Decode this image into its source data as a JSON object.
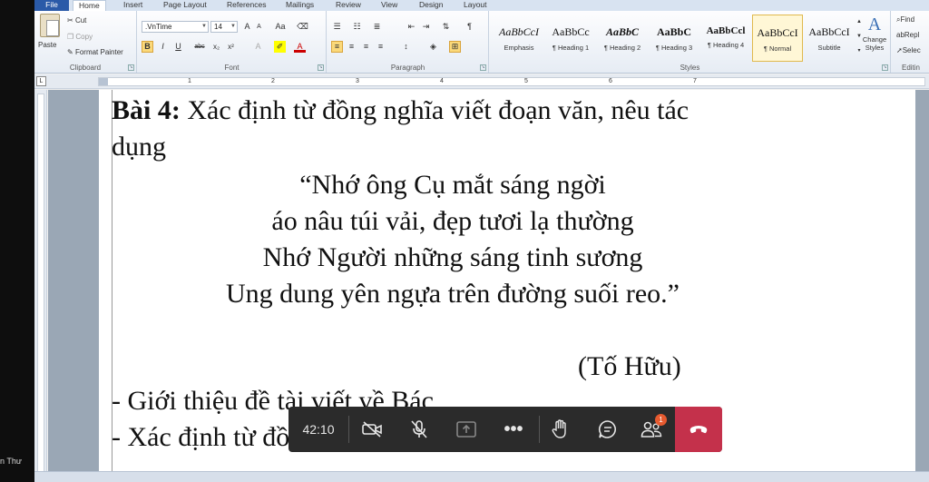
{
  "participant": {
    "name": "n Thư"
  },
  "ribbon": {
    "tabs": [
      "File",
      "Home",
      "Insert",
      "Page Layout",
      "References",
      "Mailings",
      "Review",
      "View",
      "Design",
      "Layout"
    ],
    "clipboard": {
      "paste": "Paste",
      "cut": "Cut",
      "copy": "Copy",
      "format_painter": "Format Painter",
      "label": "Clipboard"
    },
    "font": {
      "name": ".VnTime",
      "size": "14",
      "label": "Font",
      "bold": "B",
      "italic": "I",
      "underline": "U",
      "strike": "abc",
      "subscript": "x₂",
      "superscript": "x²"
    },
    "paragraph": {
      "label": "Paragraph"
    },
    "styles": {
      "label": "Styles",
      "items": [
        {
          "sample": "AaBbCcI",
          "name": "Emphasis"
        },
        {
          "sample": "AaBbCc",
          "name": "¶ Heading 1"
        },
        {
          "sample": "AaBbC",
          "name": "¶ Heading 2"
        },
        {
          "sample": "AaBbC",
          "name": "¶ Heading 3"
        },
        {
          "sample": "AaBbCcl",
          "name": "¶ Heading 4"
        },
        {
          "sample": "AaBbCcI",
          "name": "¶ Normal"
        },
        {
          "sample": "AaBbCcI",
          "name": "Subtitle"
        }
      ],
      "change_styles": "Change Styles"
    },
    "editing": {
      "find": "Find",
      "replace": "Repl",
      "select": "Selec",
      "label": "Editin"
    }
  },
  "ruler": {
    "ticks": [
      "1",
      "2",
      "3",
      "4",
      "5",
      "6",
      "7"
    ]
  },
  "document": {
    "heading_bold": "Bài 4:",
    "heading_rest": " Xác định từ đồng nghĩa viết đoạn văn, nêu tác",
    "heading_line2": "dụng",
    "poem": [
      "“Nhớ ông Cụ mắt sáng ngời",
      "áo nâu túi vải, đẹp tươi lạ thường",
      "Nhớ Người những sáng tinh sương",
      "Ung dung yên ngựa trên đường suối reo.”"
    ],
    "author": "(Tố Hữu)",
    "bullet1": "- Giới thiệu đề tài viết về Bác",
    "bullet2": "- Xác định từ đồng nghĩa :"
  },
  "call": {
    "timer": "42:10",
    "participants_badge": "1",
    "colors": {
      "bar": "#2b2b2b",
      "hangup": "#c4314b",
      "badge": "#e65a2f"
    }
  }
}
